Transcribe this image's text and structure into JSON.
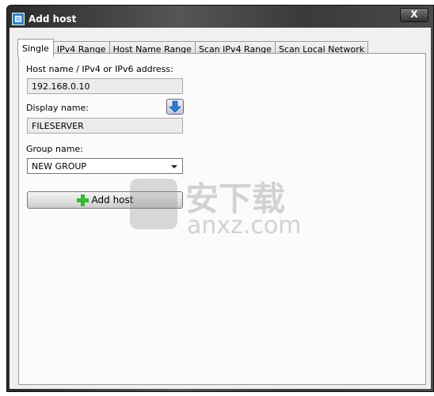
{
  "window": {
    "title": "Add host",
    "close_label": "X"
  },
  "tabs": [
    {
      "label": "Single",
      "active": true
    },
    {
      "label": "IPv4 Range"
    },
    {
      "label": "Host Name Range"
    },
    {
      "label": "Scan IPv4 Range"
    },
    {
      "label": "Scan Local Network"
    }
  ],
  "form": {
    "host_label": "Host name / IPv4 or IPv6 address:",
    "host_value": "192.168.0.10",
    "display_label": "Display name:",
    "display_value": "FILESERVER",
    "group_label": "Group name:",
    "group_value": "NEW GROUP",
    "add_button": "Add host"
  },
  "watermark": {
    "cn": "安下载",
    "en": "anxz.com"
  }
}
